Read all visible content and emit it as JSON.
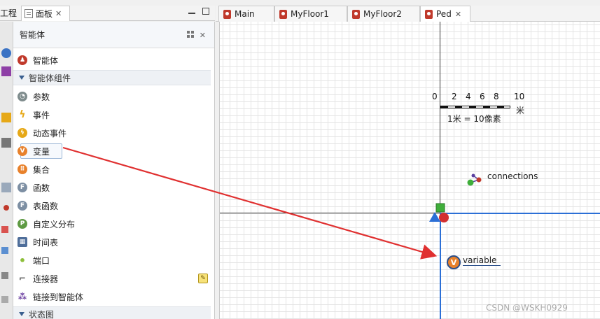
{
  "left_tabs": {
    "project": "工程",
    "palette": "面板"
  },
  "palette": {
    "title": "智能体",
    "items": [
      {
        "label": "智能体",
        "color": "#c0392b",
        "glyph": "♟"
      },
      {
        "label": "参数",
        "color": "#7f8c8d",
        "glyph": "◔"
      },
      {
        "label": "事件",
        "color": "#e6a817",
        "glyph": "ϟ"
      },
      {
        "label": "动态事件",
        "color": "#e6a817",
        "glyph": "ϟ"
      },
      {
        "label": "变量",
        "color": "#e8812b",
        "glyph": "V"
      },
      {
        "label": "集合",
        "color": "#e8812b",
        "glyph": "⠿"
      },
      {
        "label": "函数",
        "color": "#7d8fa3",
        "glyph": "F"
      },
      {
        "label": "表函数",
        "color": "#7d8fa3",
        "glyph": "F"
      },
      {
        "label": "自定义分布",
        "color": "#5e9a43",
        "glyph": "P"
      },
      {
        "label": "时间表",
        "color": "#4f6e9a",
        "glyph": "▦"
      },
      {
        "label": "端口",
        "color": "#8dbf3a",
        "glyph": "•"
      },
      {
        "label": "连接器",
        "color": "#555555",
        "glyph": "⌐"
      },
      {
        "label": "链接到智能体",
        "color": "#6b3fa0",
        "glyph": "⁂"
      }
    ],
    "section_components": "智能体组件",
    "section_statechart": "状态图"
  },
  "editor_tabs": [
    {
      "label": "Main"
    },
    {
      "label": "MyFloor1"
    },
    {
      "label": "MyFloor2"
    },
    {
      "label": "Ped"
    }
  ],
  "canvas": {
    "scale_ticks": [
      "0",
      "2",
      "4",
      "6",
      "8",
      "10"
    ],
    "scale_unit": "米",
    "scale_note": "1米 = 10像素",
    "connections_label": "connections",
    "variable_label": "variable",
    "variable_glyph": "V"
  },
  "watermark": "CSDN @WSKH0929"
}
